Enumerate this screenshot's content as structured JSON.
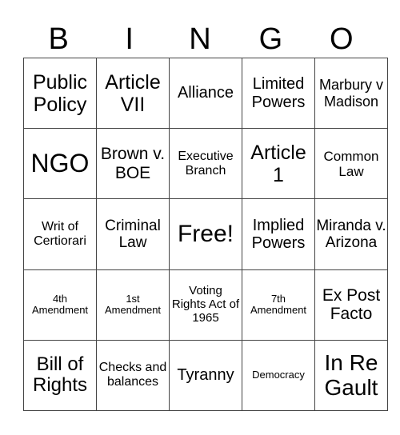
{
  "header": {
    "letters": [
      "B",
      "I",
      "N",
      "G",
      "O"
    ]
  },
  "grid": {
    "rows": [
      [
        "Public Policy",
        "Article VII",
        "Alliance",
        "Limited Powers",
        "Marbury v Madison"
      ],
      [
        "NGO",
        "Brown v. BOE",
        "Executive Branch",
        "Article 1",
        "Common Law"
      ],
      [
        "Writ of Certiorari",
        "Criminal Law",
        "Free!",
        "Implied Powers",
        "Miranda v. Arizona"
      ],
      [
        "4th Amendment",
        "1st Amendment",
        "Voting Rights Act of 1965",
        "7th Amendment",
        "Ex Post Facto"
      ],
      [
        "Bill of Rights",
        "Checks and balances",
        "Tyranny",
        "Democracy",
        "In Re Gault"
      ]
    ]
  }
}
